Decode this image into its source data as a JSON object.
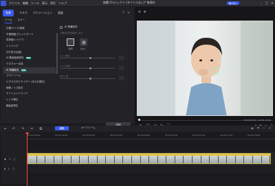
{
  "menubar": {
    "items": [
      "ファイル",
      "編集",
      "ツール",
      "表示",
      "再生",
      "ヘルプ"
    ],
    "project_title": "無題プロジェクト (タイトルなし)* 無保存",
    "export_label": "書き出し",
    "window_controls": [
      "minimize-icon",
      "maximize-icon",
      "close-icon"
    ]
  },
  "left_panel": {
    "tabs": [
      {
        "label": "効果",
        "active": true
      },
      {
        "label": "マスク",
        "active": false
      },
      {
        "label": "アニメーション",
        "active": false
      },
      {
        "label": "速度",
        "active": false
      }
    ],
    "subtabs": [
      {
        "label": "ツール",
        "active": true
      },
      {
        "label": "カラー",
        "active": false
      }
    ],
    "tools": [
      {
        "label": "位置/サイズ/回転",
        "badge": "",
        "selected": false
      },
      {
        "label": "不透明度/ブレンドモード",
        "badge": "",
        "selected": false
      },
      {
        "label": "境界線/シャドウ",
        "badge": "",
        "selected": false
      },
      {
        "label": "トリミング",
        "badge": "",
        "selected": false
      },
      {
        "label": "切り抜き/反転",
        "badge": "",
        "selected": false
      },
      {
        "label": "AI 動画高画質化",
        "badge": "NEW",
        "selected": false
      },
      {
        "label": "クロマキー合成",
        "badge": "",
        "selected": false
      },
      {
        "label": "AI 背景除去",
        "badge": "NEW",
        "selected": true
      },
      {
        "label": "ブラシツール",
        "badge": "",
        "selected": false
      },
      {
        "label": "ビデオスタビライザー (手ぶれ補正)",
        "badge": "",
        "selected": false
      },
      {
        "label": "映像ノイズ除去",
        "badge": "",
        "selected": false
      },
      {
        "label": "モーショントラック",
        "badge": "",
        "selected": false
      },
      {
        "label": "レンズ補正",
        "badge": "",
        "selected": false
      },
      {
        "label": "動画逆再生",
        "badge": "",
        "selected": false
      }
    ],
    "settings": {
      "checkbox_label": "AI 背景除去",
      "hint": "人物の背景を除去します",
      "modes": [
        {
          "label": "透明",
          "icon": "checker-icon"
        },
        {
          "label": "ぼかし",
          "icon": "blur-icon"
        }
      ],
      "sliders": [
        {
          "label": "エッジ強さ",
          "value": 0.55
        },
        {
          "label": "エッジ位置",
          "value": 0.55
        },
        {
          "label": "ぼかし量",
          "value": 0.55
        }
      ],
      "detail_button": "詳細"
    }
  },
  "viewer": {
    "timecode": "00:00:00:00 / 00:00:10:00",
    "play_icons": [
      "play-icon",
      "stop-icon",
      "prev-frame-icon",
      "next-frame-icon",
      "fullscreen-icon"
    ]
  },
  "timeline": {
    "tab_active": "編集",
    "tab_other": "キーフレーム",
    "ruler_ticks": [
      "00:00:00:00",
      "00:00:02:00",
      "00:00:04:00",
      "00:00:06:00",
      "00:00:08:00",
      "00:00:10:00",
      "00:00:12:00",
      "00:00:14:00",
      "00:00:16:00"
    ],
    "track_labels": [
      "1",
      "1"
    ]
  },
  "colors": {
    "accent": "#3b5bf0",
    "clip": "#c9b44a",
    "playhead": "#ff4a4a",
    "badge": "#2fb8a0"
  }
}
